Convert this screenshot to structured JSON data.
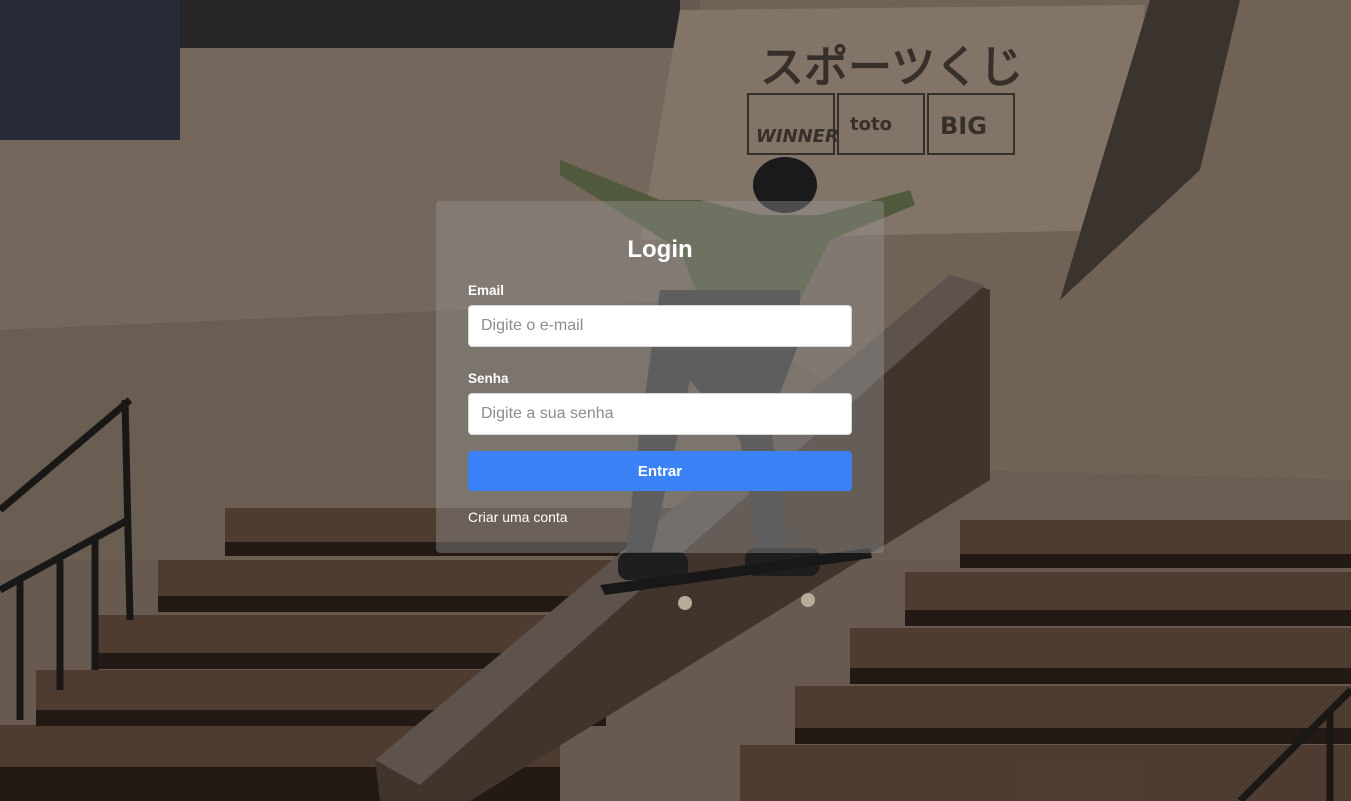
{
  "login": {
    "title": "Login",
    "email_label": "Email",
    "email_placeholder": "Digite o e-mail",
    "password_label": "Senha",
    "password_placeholder": "Digite a sua senha",
    "submit_label": "Entrar",
    "signup_link": "Criar uma conta"
  },
  "background": {
    "sign_text": "スポーツくじ",
    "sign_brands": [
      "WINNER",
      "toto",
      "BIG"
    ]
  },
  "colors": {
    "accent": "#3b82f6",
    "card": "rgba(150,150,150,0.42)"
  }
}
